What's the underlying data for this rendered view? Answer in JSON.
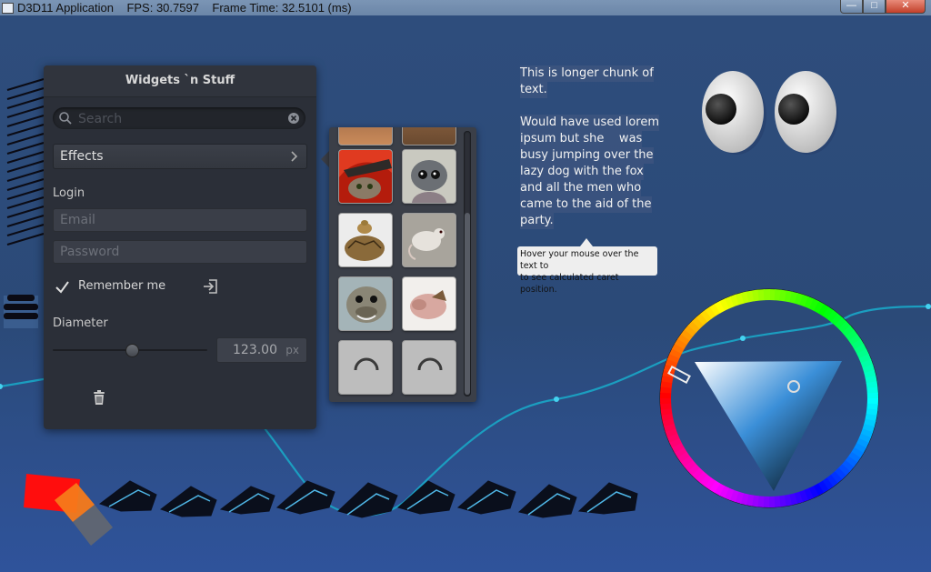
{
  "window": {
    "title": "D3D11 Application    FPS: 30.7597    Frame Time: 32.5101 (ms)",
    "controls": {
      "minimize": "—",
      "maximize": "□",
      "close": "✕"
    }
  },
  "panel": {
    "title": "Widgets `n Stuff",
    "search": {
      "placeholder": "Search",
      "value": "",
      "search_icon": "search-icon",
      "clear_icon": "clear-icon"
    },
    "effects_button": {
      "label": "Effects",
      "icon": "chevron-right-icon"
    },
    "login": {
      "label": "Login",
      "email_placeholder": "Email",
      "password_placeholder": "Password",
      "remember_label": "Remember me",
      "remember_checked": true,
      "login_icon": "sign-in-icon"
    },
    "diameter": {
      "label": "Diameter",
      "slider_value": 0.5,
      "value": "123.00",
      "unit": "px"
    },
    "trash_icon": "trash-icon"
  },
  "image_popup": {
    "tiles": [
      {
        "name": "cat-red-hat",
        "icon": "cat-image"
      },
      {
        "name": "lemur-image",
        "icon": "lemur-image"
      },
      {
        "name": "tortoise-image",
        "icon": "tortoise-image"
      },
      {
        "name": "mouse-image",
        "icon": "mouse-image"
      },
      {
        "name": "seal-image",
        "icon": "seal-image"
      },
      {
        "name": "pig-image",
        "icon": "pig-image"
      },
      {
        "name": "loading-tile-1",
        "icon": "spinner-icon"
      },
      {
        "name": "loading-tile-2",
        "icon": "spinner-icon"
      }
    ]
  },
  "text_block": {
    "lines": [
      "This is longer chunk of",
      "text.",
      "",
      "Would have used lorem",
      "ipsum but she    was",
      "busy jumping over the",
      "lazy dog with the fox",
      "and all the men who",
      "came to the aid of the",
      "party."
    ],
    "tooltip_line1": "Hover your mouse over the text to",
    "tooltip_line2": "to see calculated caret position."
  },
  "color_wheel": {
    "selected_color": "#3c8fd8",
    "hue_degrees": 205
  },
  "colors": {
    "background": "#2c4a78",
    "panel": "#2b2f38",
    "accent_line": "#1a9fc0"
  }
}
